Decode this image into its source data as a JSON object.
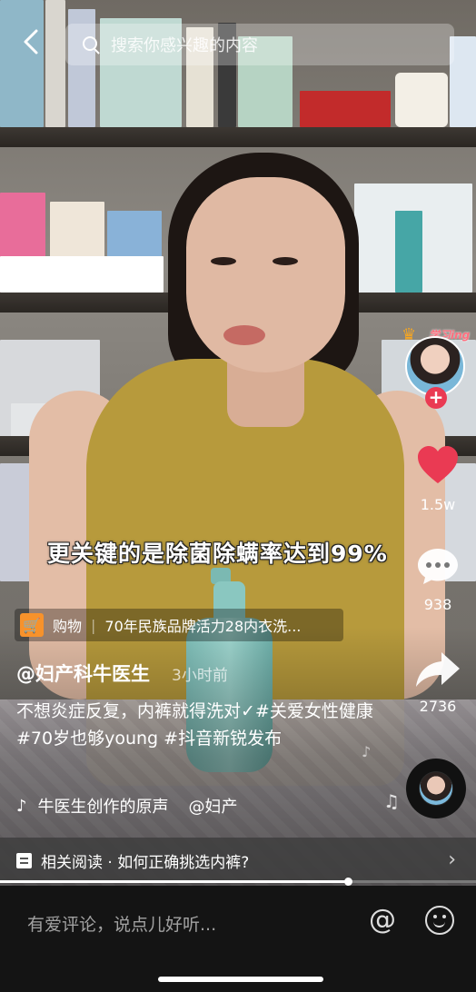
{
  "search": {
    "placeholder": "搜索你感兴趣的内容"
  },
  "video": {
    "subtitle": "更关键的是除菌除螨率达到99%",
    "progress_fraction": 0.73
  },
  "creator": {
    "avatar_badge": "学习ing"
  },
  "actions": {
    "likes": "1.5w",
    "comments": "938",
    "shares": "2736"
  },
  "shopping": {
    "label": "购物",
    "title": "70年民族品牌活力28内衣洗..."
  },
  "post": {
    "author": "@妇产科牛医生",
    "time": "3小时前",
    "description": "不想炎症反复，内裤就得洗对✓#关爱女性健康 #70岁也够young #抖音新锐发布"
  },
  "music": {
    "title": "牛医生创作的原声",
    "author": "@妇产"
  },
  "related": {
    "text": "相关阅读 · 如何正确挑选内裤?"
  },
  "comment_bar": {
    "placeholder": "有爱评论，说点儿好听..."
  },
  "colors": {
    "like_red": "#ea3a53",
    "cart_orange": "#f7922b"
  }
}
